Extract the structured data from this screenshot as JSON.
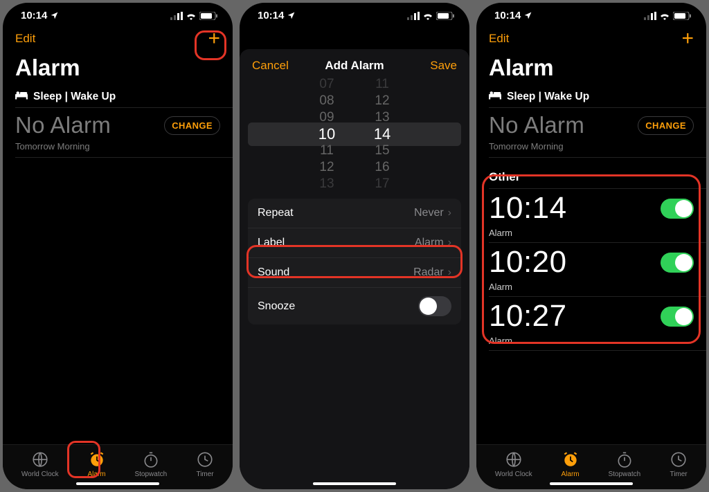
{
  "status": {
    "time": "10:14"
  },
  "colors": {
    "accent": "#fe9f0a",
    "highlight": "#e33426",
    "toggle_on": "#30d158"
  },
  "screen1": {
    "edit": "Edit",
    "title": "Alarm",
    "sleep_header": "Sleep | Wake Up",
    "no_alarm": "No Alarm",
    "no_alarm_sub": "Tomorrow Morning",
    "change": "CHANGE",
    "tabs": [
      "World Clock",
      "Alarm",
      "Stopwatch",
      "Timer"
    ],
    "active_tab": 1
  },
  "screen2": {
    "cancel": "Cancel",
    "title": "Add Alarm",
    "save": "Save",
    "picker": {
      "hours": [
        "07",
        "08",
        "09",
        "10",
        "11",
        "12",
        "13"
      ],
      "minutes": [
        "11",
        "12",
        "13",
        "14",
        "15",
        "16",
        "17"
      ],
      "selected_hour": "10",
      "selected_minute": "14"
    },
    "rows": {
      "repeat_label": "Repeat",
      "repeat_value": "Never",
      "label_label": "Label",
      "label_value": "Alarm",
      "sound_label": "Sound",
      "sound_value": "Radar",
      "snooze_label": "Snooze",
      "snooze_on": false
    }
  },
  "screen3": {
    "edit": "Edit",
    "title": "Alarm",
    "sleep_header": "Sleep | Wake Up",
    "no_alarm": "No Alarm",
    "no_alarm_sub": "Tomorrow Morning",
    "change": "CHANGE",
    "other_header": "Other",
    "alarms": [
      {
        "time": "10:14",
        "label": "Alarm",
        "on": true
      },
      {
        "time": "10:20",
        "label": "Alarm",
        "on": true
      },
      {
        "time": "10:27",
        "label": "Alarm",
        "on": true
      }
    ],
    "tabs": [
      "World Clock",
      "Alarm",
      "Stopwatch",
      "Timer"
    ],
    "active_tab": 1
  }
}
